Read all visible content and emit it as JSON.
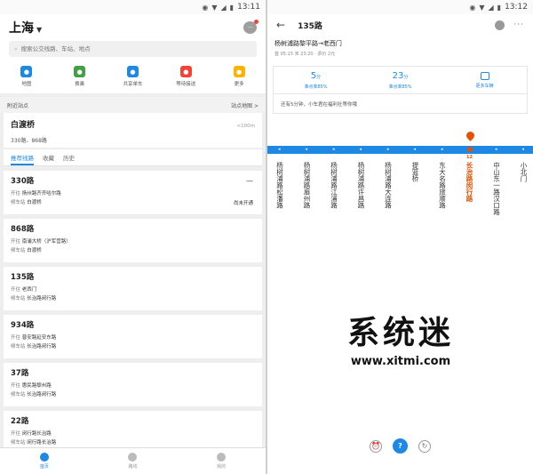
{
  "left": {
    "status_time": "13:11",
    "city": "上海",
    "search_placeholder": "搜索公交线路、车站、地点",
    "quick": [
      {
        "label": "地图",
        "icon": "map-pin-icon",
        "color": "#1e88e5"
      },
      {
        "label": "换乘",
        "icon": "bus-icon",
        "color": "#43a047"
      },
      {
        "label": "共享单车",
        "icon": "bike-icon",
        "color": "#1e88e5"
      },
      {
        "label": "等待接送",
        "icon": "gift-icon",
        "color": "#f44336"
      },
      {
        "label": "更多",
        "icon": "grid-icon",
        "color": "#ffb300"
      }
    ],
    "nearby_label": "附近站点",
    "nearby_map": "站点地图 >",
    "station": {
      "name": "白渡桥",
      "distance": "<100m",
      "lines": "330路、868路"
    },
    "tabs": [
      "推荐线路",
      "收藏",
      "历史"
    ],
    "labels": {
      "dest": "开往",
      "boarding": "候车站"
    },
    "routes": [
      {
        "num": "330路",
        "dest": "扬州路齐齐哈尔路",
        "stop": "白渡桥",
        "mark": "—",
        "status": "尚未开通"
      },
      {
        "num": "868路",
        "dest": "南浦大桥（沪军营路）",
        "stop": "白渡桥",
        "mark": "",
        "status": ""
      },
      {
        "num": "135路",
        "dest": "老西门",
        "stop": "长治路闵行路",
        "mark": "",
        "status": ""
      },
      {
        "num": "934路",
        "dest": "普安路延安东路",
        "stop": "长治路闵行路",
        "mark": "",
        "status": ""
      },
      {
        "num": "37路",
        "dest": "惠民路黎州路",
        "stop": "长治路闵行路",
        "mark": "",
        "status": ""
      },
      {
        "num": "22路",
        "dest": "闵行路长治路",
        "stop": "闵行路长治路",
        "mark": "",
        "status": ""
      }
    ],
    "nav": [
      "首页",
      "路线",
      "我的"
    ]
  },
  "right": {
    "status_time": "13:12",
    "title": "135路",
    "direction": "杨树浦路黎平路→老西门",
    "meta": "首 05:15 末 23:20 · 票价 2元",
    "wait1": "5",
    "wait1_unit": "分",
    "wait1_label": "准点率85%",
    "wait2": "23",
    "wait2_unit": "分",
    "wait2_label": "准点率85%",
    "more_label": "更多车辆",
    "notice": "还有5分钟，小车君在福利社等你哦",
    "current_stop_index": 6,
    "stops": [
      {
        "idx": "",
        "name": "杨树浦路松潘路"
      },
      {
        "idx": "",
        "name": "杨树浦路眉州路"
      },
      {
        "idx": "",
        "name": "杨树浦路江浦路"
      },
      {
        "idx": "",
        "name": "杨树浦路许昌路"
      },
      {
        "idx": "",
        "name": "杨树浦路大连路"
      },
      {
        "idx": "",
        "name": "提篮桥"
      },
      {
        "idx": "",
        "name": "东大名路旅顺路"
      },
      {
        "idx": "12",
        "name": "长治路闵行路"
      },
      {
        "idx": "",
        "name": "中山东一路汉口路"
      },
      {
        "idx": "",
        "name": "小北门"
      }
    ],
    "watermark_cn": "系统迷",
    "watermark_url": "www.xitmi.com"
  }
}
